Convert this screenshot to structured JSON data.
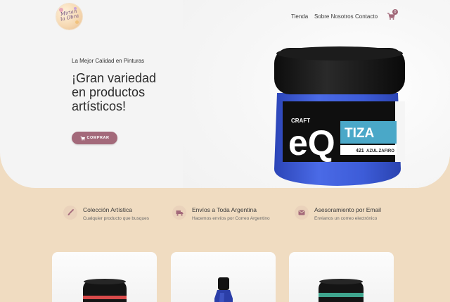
{
  "header": {
    "logo_text": "Mirian la Obra",
    "nav": [
      {
        "label": "Tienda"
      },
      {
        "label": "Sobre Nosotros"
      },
      {
        "label": "Contacto"
      }
    ],
    "cart_count": "0"
  },
  "hero": {
    "eyebrow": "La Mejor Calidad en Pinturas",
    "headline": "¡Gran variedad en productos artísticos!",
    "button_label": "COMPRAR",
    "product": {
      "brand_small": "CRAFT",
      "brand": "eQ",
      "line": "TIZA",
      "code": "421",
      "color_name": "AZUL ZAFIRO"
    }
  },
  "features": [
    {
      "icon": "brush-icon",
      "title": "Colección Artística",
      "subtitle": "Cualquier producto que busques"
    },
    {
      "icon": "truck-icon",
      "title": "Envíos a Toda Argentina",
      "subtitle": "Hacemos envíos por Correo Argentino"
    },
    {
      "icon": "envelope-icon",
      "title": "Asesoramiento por Email",
      "subtitle": "Envianos un correo electrónico"
    }
  ],
  "products": [
    {
      "icon": "jar-red-lid"
    },
    {
      "icon": "blue-bottle"
    },
    {
      "icon": "jar-green-lid"
    }
  ],
  "colors": {
    "accent": "#a3697a",
    "beige": "#f0dcc1",
    "hero_bg": "#f4f4f4",
    "jar_blue": "#3f5fd6"
  }
}
